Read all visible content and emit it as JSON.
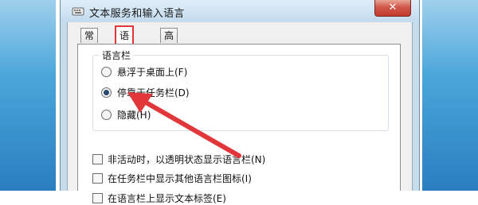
{
  "window": {
    "title": "文本服务和输入语言",
    "close_label": "✕"
  },
  "tabs": [
    {
      "label": "常规",
      "active": false
    },
    {
      "label": "语言栏",
      "active": true
    },
    {
      "label": "高级键设置",
      "active": false
    }
  ],
  "language_bar_group": {
    "label": "语言栏",
    "options": [
      {
        "label": "悬浮于桌面上(F)",
        "checked": false
      },
      {
        "label": "停靠于任务栏(D)",
        "checked": true
      },
      {
        "label": "隐藏(H)",
        "checked": false
      }
    ]
  },
  "checkboxes": [
    {
      "label": "非活动时，以透明状态显示语言栏(N)",
      "checked": false
    },
    {
      "label": "在任务栏中显示其他语言栏图标(I)",
      "checked": false
    },
    {
      "label": "在语言栏上显示文本标签(E)",
      "checked": false
    }
  ],
  "colors": {
    "highlight": "#e2373a"
  }
}
